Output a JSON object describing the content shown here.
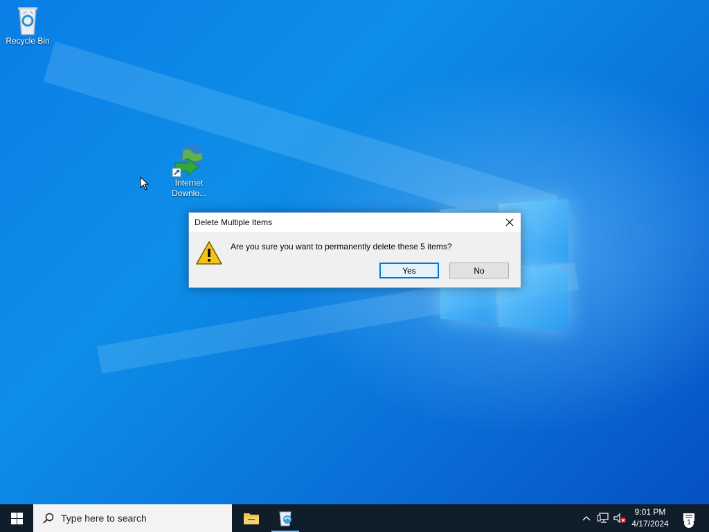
{
  "desktop": {
    "icons": [
      {
        "label": "Recycle Bin"
      },
      {
        "label": "Internet Downlo..."
      }
    ]
  },
  "dialog": {
    "title": "Delete Multiple Items",
    "message": "Are you sure you want to permanently delete these 5 items?",
    "buttons": {
      "yes": "Yes",
      "no": "No"
    },
    "close_icon": "close-icon",
    "warning_icon": "warning-icon"
  },
  "taskbar": {
    "search_placeholder": "Type here to search",
    "apps": [
      {
        "name": "File Explorer",
        "icon": "folder-icon"
      },
      {
        "name": "Recycle Bin",
        "icon": "recycle-bin-icon"
      }
    ],
    "clock": {
      "time": "9:01 PM",
      "date": "4/17/2024"
    },
    "notification_count": "1"
  },
  "colors": {
    "accent": "#0078d7",
    "taskbar": "#101d2b",
    "desktop": "#0a6fd8"
  }
}
